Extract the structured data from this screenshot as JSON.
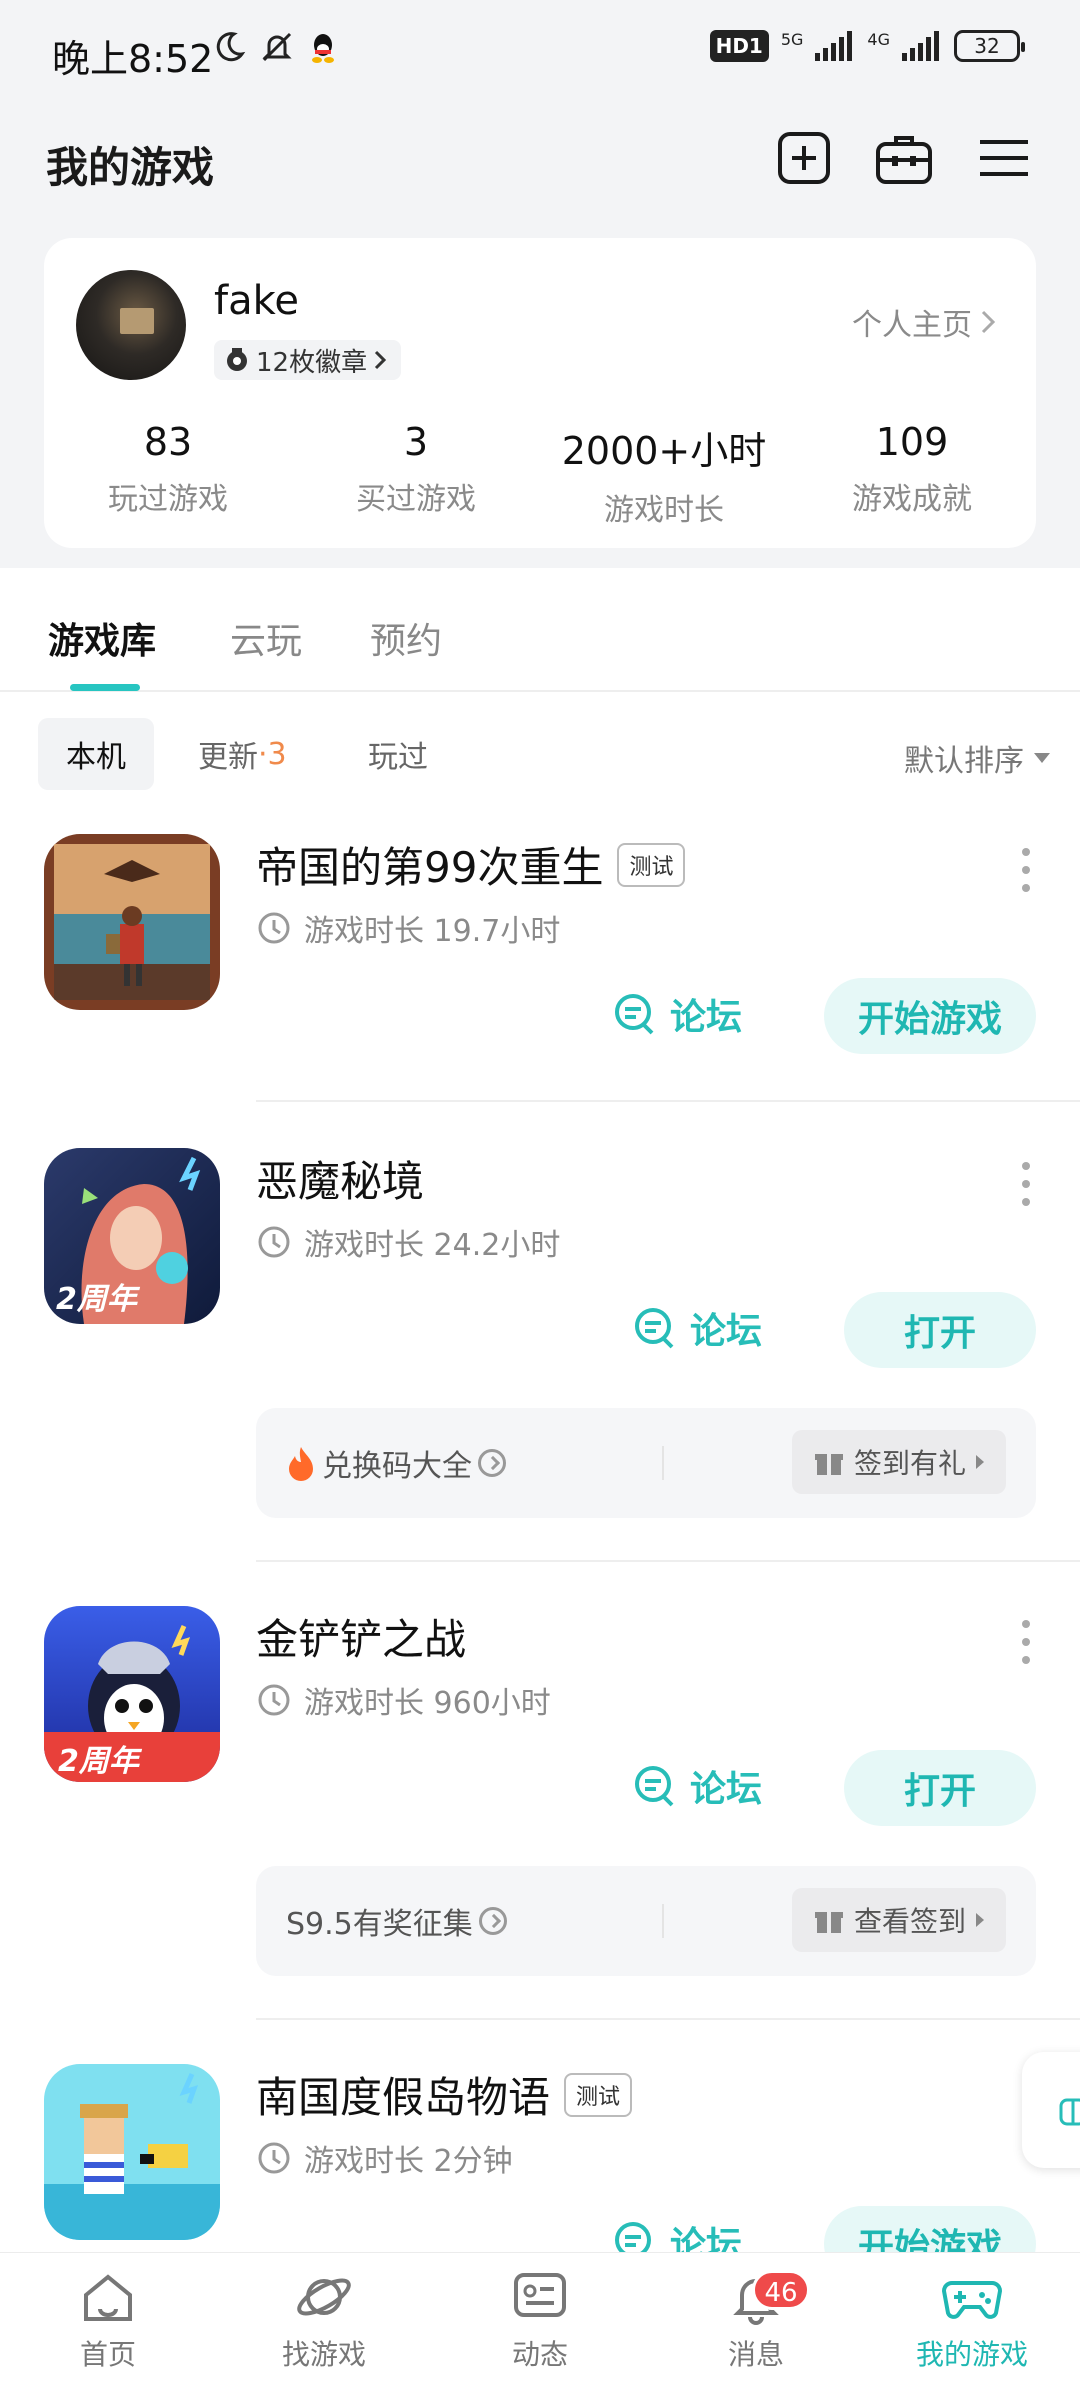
{
  "status_bar": {
    "time": "晚上8:52",
    "hd_badge": "HD1",
    "net1": "5G",
    "net2": "4G",
    "battery": "32"
  },
  "header": {
    "title": "我的游戏",
    "icons": [
      "add-icon",
      "toolbox-icon",
      "menu-icon"
    ]
  },
  "profile": {
    "username": "fake",
    "badges": "12枚徽章",
    "profile_link": "个人主页",
    "stats": [
      {
        "value": "83",
        "label": "玩过游戏"
      },
      {
        "value": "3",
        "label": "买过游戏"
      },
      {
        "value": "2000+小时",
        "label": "游戏时长"
      },
      {
        "value": "109",
        "label": "游戏成就"
      }
    ]
  },
  "tabs": [
    {
      "label": "游戏库",
      "active": true
    },
    {
      "label": "云玩",
      "active": false
    },
    {
      "label": "预约",
      "active": false
    }
  ],
  "filters": {
    "local": "本机",
    "update": "更新",
    "update_sep": "·",
    "update_count": "3",
    "played": "玩过",
    "sort": "默认排序"
  },
  "games": [
    {
      "name": "帝国的第99次重生",
      "tag": "测试",
      "playtime": "游戏时长 19.7小时",
      "forum": "论坛",
      "action": "开始游戏"
    },
    {
      "name": "恶魔秘境",
      "playtime": "游戏时长 24.2小时",
      "forum": "论坛",
      "action": "打开",
      "promo_left": "兑换码大全",
      "promo_right": "签到有礼"
    },
    {
      "name": "金铲铲之战",
      "playtime": "游戏时长 960小时",
      "forum": "论坛",
      "action": "打开",
      "promo_left": "S9.5有奖征集",
      "promo_right": "查看签到"
    },
    {
      "name": "南国度假岛物语",
      "tag": "测试",
      "playtime": "游戏时长 2分钟",
      "forum": "论坛",
      "action": "开始游戏"
    }
  ],
  "icon_badges": {
    "anniversary": "2周年"
  },
  "bottom_nav": [
    {
      "label": "首页",
      "icon": "home-icon"
    },
    {
      "label": "找游戏",
      "icon": "planet-icon"
    },
    {
      "label": "动态",
      "icon": "feed-icon"
    },
    {
      "label": "消息",
      "icon": "bell-icon",
      "badge": "46"
    },
    {
      "label": "我的游戏",
      "icon": "gamepad-icon",
      "active": true
    }
  ],
  "colors": {
    "accent": "#1fb7b2",
    "update_count": "#f08a4b",
    "badge": "#ef4a4a"
  }
}
